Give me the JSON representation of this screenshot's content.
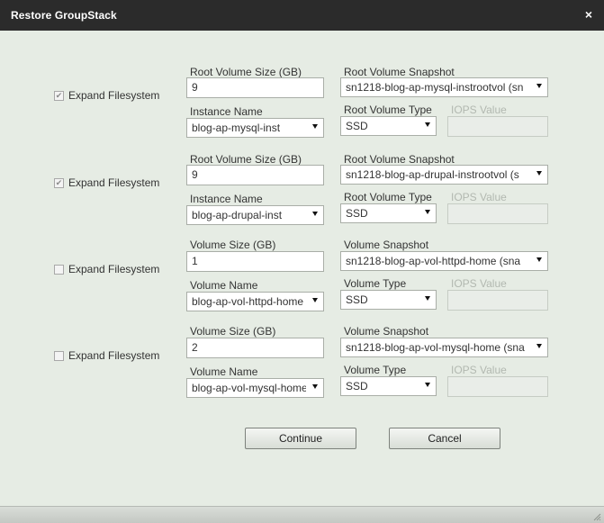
{
  "dialog": {
    "title": "Restore GroupStack",
    "close_icon": "×"
  },
  "groups": [
    {
      "checkbox_label": "Expand Filesystem",
      "checked": true,
      "size_label": "Root Volume Size (GB)",
      "size_value": "9",
      "snapshot_label": "Root Volume Snapshot",
      "snapshot_value": "sn1218-blog-ap-mysql-instrootvol (sn",
      "name_label": "Instance Name",
      "name_value": "blog-ap-mysql-inst",
      "type_label": "Root Volume Type",
      "type_value": "SSD",
      "iops_label": "IOPS Value",
      "iops_value": ""
    },
    {
      "checkbox_label": "Expand Filesystem",
      "checked": true,
      "size_label": "Root Volume Size (GB)",
      "size_value": "9",
      "snapshot_label": "Root Volume Snapshot",
      "snapshot_value": "sn1218-blog-ap-drupal-instrootvol (s",
      "name_label": "Instance Name",
      "name_value": "blog-ap-drupal-inst",
      "type_label": "Root Volume Type",
      "type_value": "SSD",
      "iops_label": "IOPS Value",
      "iops_value": ""
    },
    {
      "checkbox_label": "Expand Filesystem",
      "checked": false,
      "size_label": "Volume Size (GB)",
      "size_value": "1",
      "snapshot_label": "Volume Snapshot",
      "snapshot_value": "sn1218-blog-ap-vol-httpd-home (sna",
      "name_label": "Volume Name",
      "name_value": "blog-ap-vol-httpd-home",
      "type_label": "Volume Type",
      "type_value": "SSD",
      "iops_label": "IOPS Value",
      "iops_value": ""
    },
    {
      "checkbox_label": "Expand Filesystem",
      "checked": false,
      "size_label": "Volume Size (GB)",
      "size_value": "2",
      "snapshot_label": "Volume Snapshot",
      "snapshot_value": "sn1218-blog-ap-vol-mysql-home (sna",
      "name_label": "Volume Name",
      "name_value": "blog-ap-vol-mysql-home",
      "type_label": "Volume Type",
      "type_value": "SSD",
      "iops_label": "IOPS Value",
      "iops_value": ""
    }
  ],
  "buttons": {
    "continue_label": "Continue",
    "cancel_label": "Cancel"
  },
  "icons": {
    "check": "✔",
    "dropdown": "chevron-down-icon",
    "close": "close-icon",
    "resize": "resize-grip-icon"
  }
}
